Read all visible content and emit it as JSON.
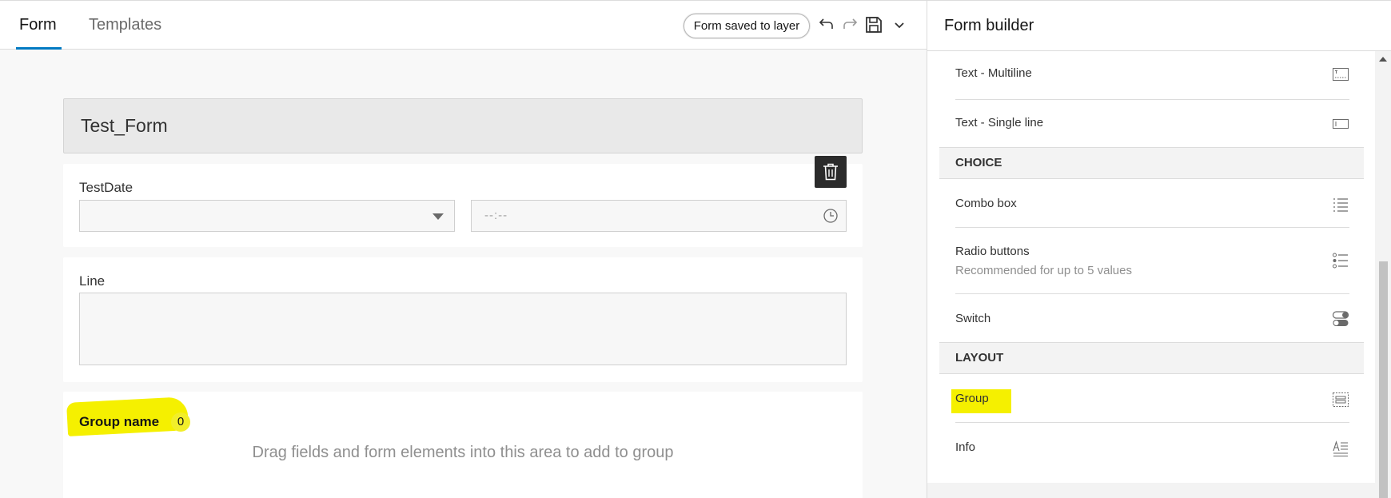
{
  "editor": {
    "tabs": [
      {
        "label": "Form",
        "active": true
      },
      {
        "label": "Templates",
        "active": false
      }
    ],
    "status": "Form saved to layer",
    "toolbar_icons": [
      "undo-icon",
      "redo-icon",
      "save-icon",
      "chevron-down-icon"
    ],
    "form_title": "Test_Form",
    "fields": {
      "date": {
        "label": "TestDate",
        "date_value": "",
        "time_placeholder": "--:--"
      },
      "line": {
        "label": "Line",
        "value": ""
      }
    },
    "group": {
      "name": "Group name",
      "count": "0",
      "hint": "Drag fields and form elements into this area to add to group"
    }
  },
  "builder": {
    "title": "Form builder",
    "items_top": [
      {
        "label": "Text - Multiline",
        "icon": "text-multiline-icon"
      },
      {
        "label": "Text - Single line",
        "icon": "text-single-line-icon"
      }
    ],
    "choice": {
      "heading": "CHOICE",
      "items": [
        {
          "label": "Combo box",
          "icon": "list-icon"
        },
        {
          "label": "Radio buttons",
          "sublabel": "Recommended for up to 5 values",
          "icon": "radio-list-icon"
        },
        {
          "label": "Switch",
          "icon": "toggle-icon"
        }
      ]
    },
    "layout": {
      "heading": "LAYOUT",
      "items": [
        {
          "label": "Group",
          "icon": "group-icon",
          "highlighted": true
        },
        {
          "label": "Info",
          "icon": "info-text-icon"
        }
      ]
    }
  },
  "colors": {
    "accent": "#007ac2",
    "highlight": "#f5f000",
    "delete_button": "#2b2b2b"
  }
}
